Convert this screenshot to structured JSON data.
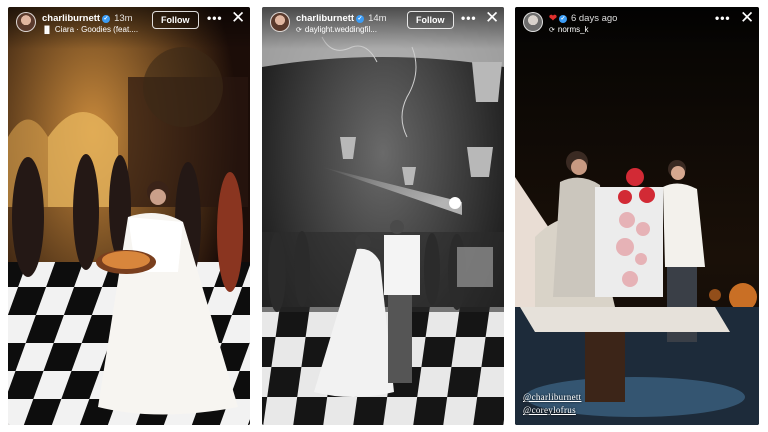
{
  "stories": [
    {
      "username": "charliburnett",
      "time": "13m",
      "subtitle_icon": "music-icon",
      "subtitle": "Ciara · Goodies (feat....",
      "follow_label": "Follow",
      "more_label": "•••",
      "close_label": "✕"
    },
    {
      "username": "charliburnett",
      "time": "14m",
      "subtitle_icon": "repost-icon",
      "subtitle": "daylight.weddingfil...",
      "follow_label": "Follow",
      "more_label": "•••",
      "close_label": "✕"
    },
    {
      "username_badge": "❤",
      "time": "6 days ago",
      "subtitle_icon": "repost-icon",
      "subtitle": "norms_k",
      "more_label": "•••",
      "close_label": "✕",
      "mentions": [
        "@charliburnett",
        "@coreylofrus"
      ]
    }
  ],
  "colors": {
    "verified": "#3b9cf5",
    "floor_dark": "#0d0d0d",
    "roses": "#d22a35"
  }
}
